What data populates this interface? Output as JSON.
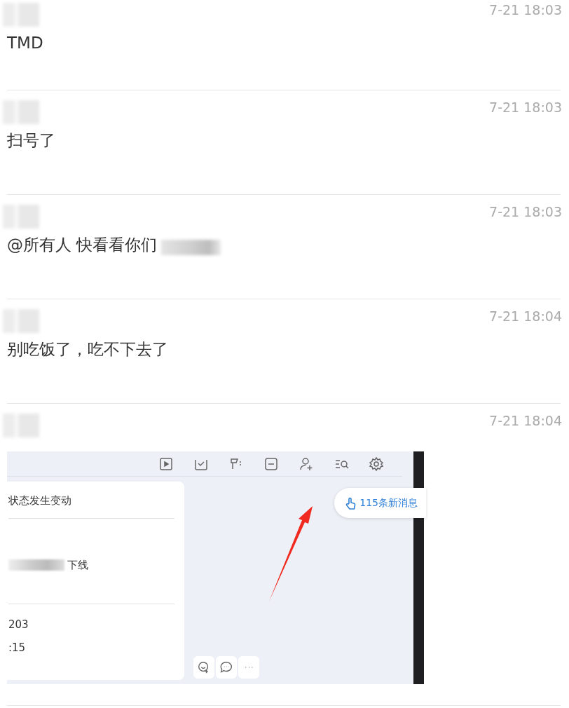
{
  "messages": [
    {
      "kind": "text",
      "time": "7-21 18:03",
      "text": "TMD"
    },
    {
      "kind": "text",
      "time": "7-21 18:03",
      "text": "扫号了"
    },
    {
      "kind": "text",
      "time": "7-21 18:03",
      "text": "@所有人 快看看你们",
      "redacted_tail": true
    },
    {
      "kind": "text",
      "time": "7-21 18:04",
      "text": "别吃饭了，吃不下去了"
    },
    {
      "kind": "image",
      "time": "7-21 18:04",
      "screenshot": {
        "card_title": "状态发生变动",
        "card_lines": [
          {
            "text": "下线",
            "redacted_prefix": true
          }
        ],
        "card_footer": [
          "203",
          ":15"
        ],
        "new_messages": "115条新消息"
      }
    }
  ]
}
